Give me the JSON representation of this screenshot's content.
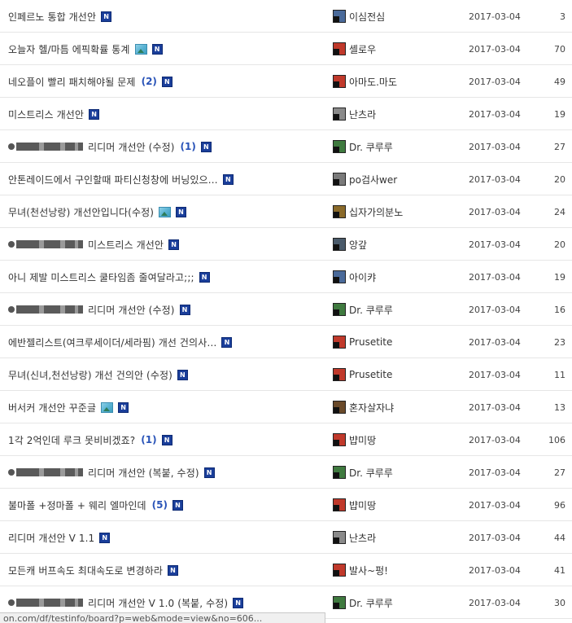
{
  "rows": [
    {
      "title": "인페르노 통합 개선안",
      "comments": "",
      "redacted": false,
      "has_image": false,
      "author": "이심전심",
      "avatar": "#4a6a9a",
      "date": "2017-03-04",
      "views": "3"
    },
    {
      "title": "오늘자 헬/마틈 에픽확률 통계",
      "comments": "",
      "redacted": false,
      "has_image": true,
      "author": "셸로우",
      "avatar": "#c0392b",
      "date": "2017-03-04",
      "views": "70"
    },
    {
      "title": "네오플이 빨리 패치해야될 문제",
      "comments": "(2)",
      "redacted": false,
      "has_image": false,
      "author": "아마도.마도",
      "avatar": "#c0392b",
      "date": "2017-03-04",
      "views": "49"
    },
    {
      "title": "미스트리스 개선안",
      "comments": "",
      "redacted": false,
      "has_image": false,
      "author": "난츠라",
      "avatar": "#8a8a8a",
      "date": "2017-03-04",
      "views": "19"
    },
    {
      "title": "리디머 개선안 (수정)",
      "comments": "(1)",
      "redacted": true,
      "has_image": false,
      "author": "Dr. 쿠루루",
      "avatar": "#3f7a3f",
      "date": "2017-03-04",
      "views": "27"
    },
    {
      "title": "안톤레이드에서 구인할때 파티신청창에 버닝있으…",
      "comments": "",
      "redacted": false,
      "has_image": false,
      "author": "po검사wer",
      "avatar": "#7a7a7a",
      "date": "2017-03-04",
      "views": "20"
    },
    {
      "title": "무녀(천선낭랑) 개선안입니다(수정)",
      "comments": "",
      "redacted": false,
      "has_image": true,
      "author": "십자가의분노",
      "avatar": "#8a6a2a",
      "date": "2017-03-04",
      "views": "24"
    },
    {
      "title": "미스트리스 개선안",
      "comments": "",
      "redacted": true,
      "has_image": false,
      "author": "앙갚",
      "avatar": "#4a5a6a",
      "date": "2017-03-04",
      "views": "20"
    },
    {
      "title": "아니 제발 미스트리스 쿨타임좀 줄여달라고;;;",
      "comments": "",
      "redacted": false,
      "has_image": false,
      "author": "아이캬",
      "avatar": "#4a6a9a",
      "date": "2017-03-04",
      "views": "19"
    },
    {
      "title": "리디머 개선안 (수정)",
      "comments": "",
      "redacted": true,
      "has_image": false,
      "author": "Dr. 쿠루루",
      "avatar": "#3f7a3f",
      "date": "2017-03-04",
      "views": "16"
    },
    {
      "title": "에반젤리스트(여크루세이더/세라핌) 개선 건의사…",
      "comments": "",
      "redacted": false,
      "has_image": false,
      "author": "Prusetite",
      "avatar": "#c0392b",
      "date": "2017-03-04",
      "views": "23"
    },
    {
      "title": "무녀(신녀,천선낭랑) 개선 건의안 (수정)",
      "comments": "",
      "redacted": false,
      "has_image": false,
      "author": "Prusetite",
      "avatar": "#c0392b",
      "date": "2017-03-04",
      "views": "11"
    },
    {
      "title": "버서커 개선안 꾸준글",
      "comments": "",
      "redacted": false,
      "has_image": true,
      "author": "혼자살자냐",
      "avatar": "#6a4a2a",
      "date": "2017-03-04",
      "views": "13"
    },
    {
      "title": "1각 2억인데 루크 못비비겠죠?",
      "comments": "(1)",
      "redacted": false,
      "has_image": false,
      "author": "뱝미땅",
      "avatar": "#c0392b",
      "date": "2017-03-04",
      "views": "106"
    },
    {
      "title": "리디머 개선안 (복붙, 수정)",
      "comments": "",
      "redacted": true,
      "has_image": false,
      "author": "Dr. 쿠루루",
      "avatar": "#3f7a3f",
      "date": "2017-03-04",
      "views": "27"
    },
    {
      "title": "불마폴 +정마폴 + 웨리 엘마인데",
      "comments": "(5)",
      "redacted": false,
      "has_image": false,
      "author": "뱝미땅",
      "avatar": "#c0392b",
      "date": "2017-03-04",
      "views": "96"
    },
    {
      "title": "리디머 개선안 V 1.1",
      "comments": "",
      "redacted": false,
      "has_image": false,
      "author": "난츠라",
      "avatar": "#8a8a8a",
      "date": "2017-03-04",
      "views": "44"
    },
    {
      "title": "모든캐 버프속도 최대속도로 변경하라",
      "comments": "",
      "redacted": false,
      "has_image": false,
      "author": "발사~펑!",
      "avatar": "#c0392b",
      "date": "2017-03-04",
      "views": "41"
    },
    {
      "title": "리디머 개선안 V 1.0 (복붙, 수정)",
      "comments": "",
      "redacted": true,
      "has_image": false,
      "author": "Dr. 쿠루루",
      "avatar": "#3f7a3f",
      "date": "2017-03-04",
      "views": "30"
    }
  ],
  "new_badge_label": "N",
  "status_url": "on.com/df/testinfo/board?p=web&mode=view&no=606..."
}
